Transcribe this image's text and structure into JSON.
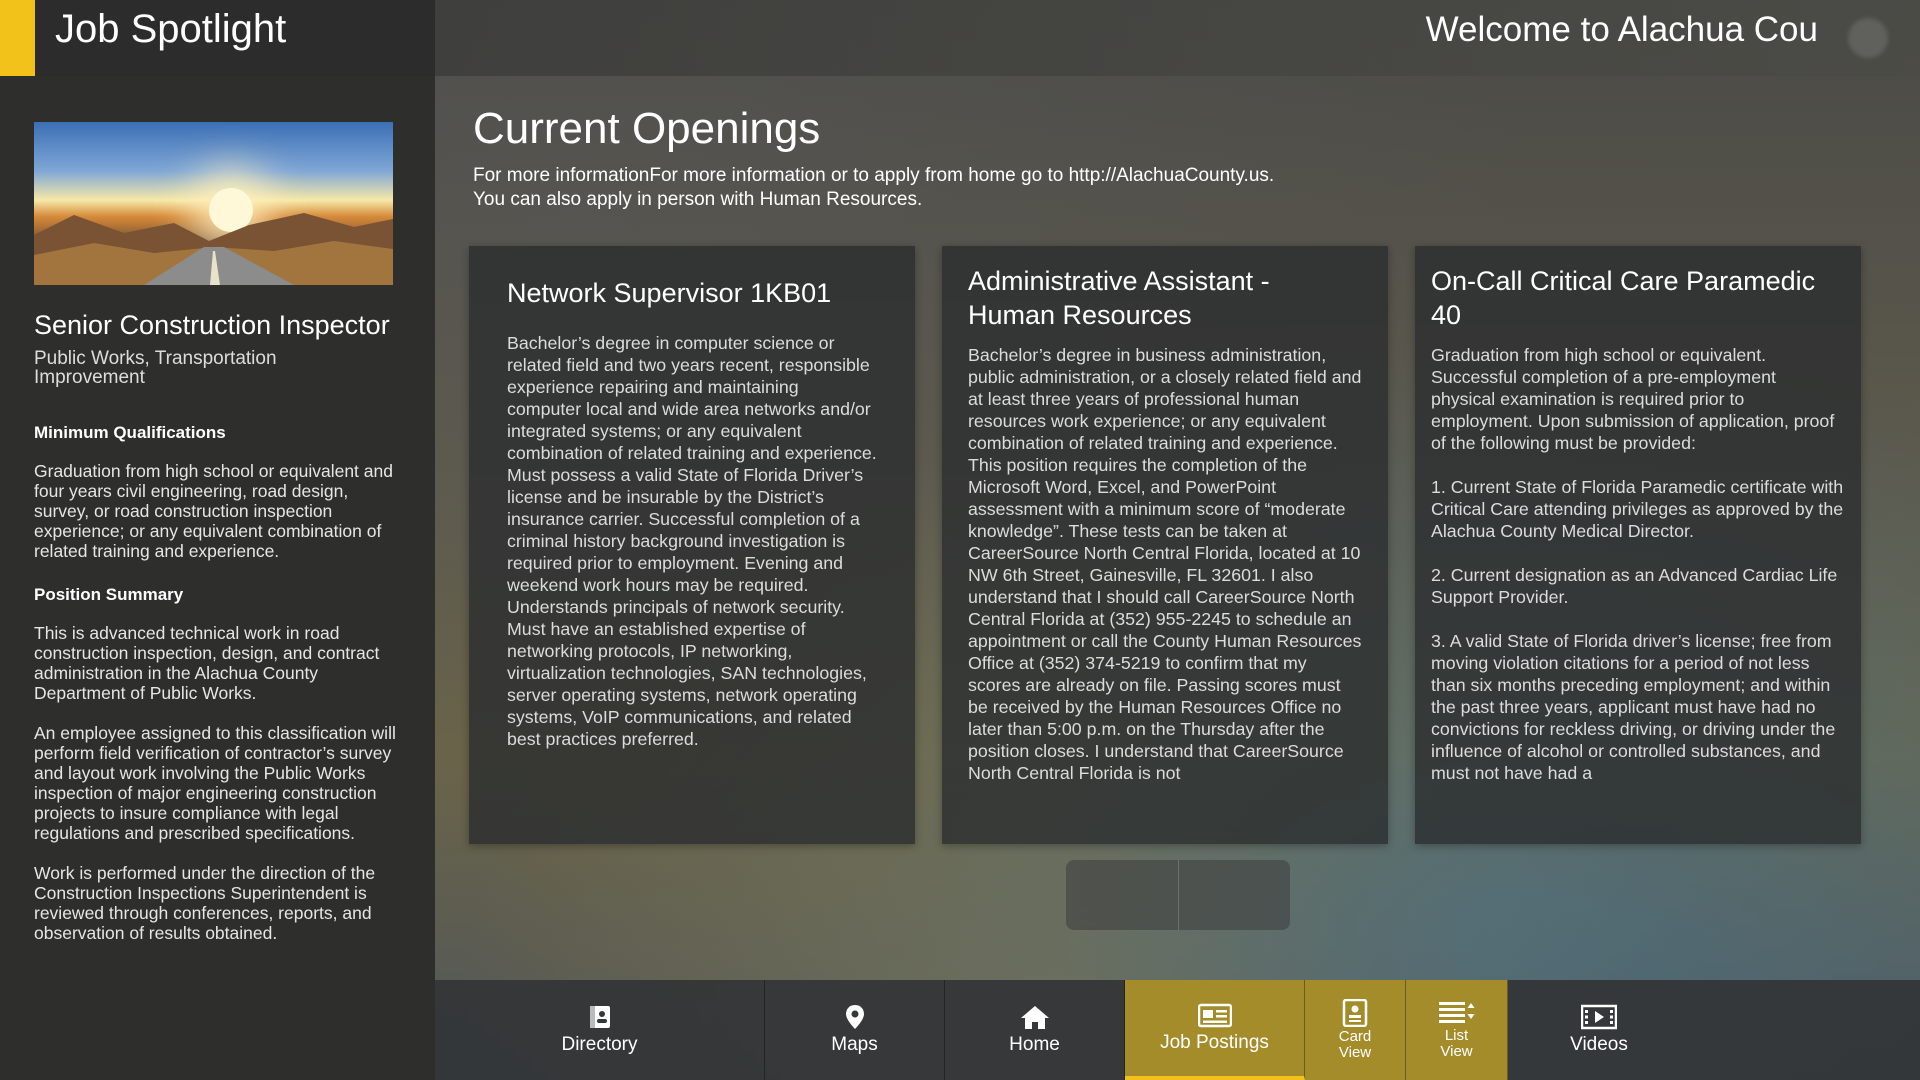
{
  "header": {
    "title": "Job Spotlight",
    "welcome": "Welcome to Alachua Cou"
  },
  "spotlight": {
    "job_title": "Senior Construction Inspector",
    "department": "Public Works, Transportation Improvement",
    "min_qual_heading": "Minimum Qualifications",
    "min_qual_text": "Graduation from high school or equivalent and four years civil engineering, road design, survey, or road construction inspection experience; or any equivalent combination of related training and experience.",
    "summary_heading": "Position Summary",
    "summary_paragraphs": [
      "This is advanced technical work in road construction inspection, design, and contract administration in the Alachua County Department of Public Works.",
      "An employee assigned to this classification will perform field verification of contractor’s survey and layout work involving the Public Works inspection of major engineering construction projects to insure compliance with legal regulations and prescribed specifications.",
      "Work is performed under the direction of the Construction Inspections Superintendent is reviewed through conferences, reports, and observation of results obtained."
    ]
  },
  "main": {
    "title": "Current Openings",
    "desc_line1": "For more informationFor more information or to apply from home go to http://AlachuaCounty.us.",
    "desc_line2": "You can also apply in person with Human Resources."
  },
  "cards": [
    {
      "title": "Network Supervisor 1KB01",
      "body": "Bachelor’s degree in computer science or related field and two years recent, responsible experience repairing and maintaining computer local and wide area networks and/or integrated systems; or any equivalent combination of related training and experience. Must possess a valid State of Florida Driver’s license and be insurable by the District’s insurance carrier. Successful completion of a criminal history background investigation is required prior to employment. Evening and weekend work hours may be required. Understands principals of network security. Must have an established expertise of networking protocols, IP networking, virtualization technologies, SAN technologies, server operating systems, network operating systems, VoIP communications, and related best practices preferred."
    },
    {
      "title": "Administrative Assistant - Human Resources",
      "body": "Bachelor’s degree in business administration, public administration, or a closely related field and at least three years of professional human resources work experience; or any equivalent combination of related training and experience. This position requires the completion of the Microsoft Word, Excel, and PowerPoint assessment with a minimum score of “moderate knowledge”. These tests can be taken at CareerSource North Central Florida, located at 10 NW 6th Street, Gainesville, FL 32601. I also understand that I should call CareerSource North Central Florida at (352) 955-2245 to schedule an appointment or call the County Human Resources Office at (352) 374-5219 to confirm that my scores are already on file. Passing scores must be received by the Human Resources Office no later than 5:00 p.m. on  the Thursday after the position closes. I understand that CareerSource North Central Florida is not"
    },
    {
      "title": "On-Call Critical Care Paramedic 40",
      "body": "Graduation from high school or equivalent. Successful completion of a pre-employment physical examination is required prior to employment. Upon submission of application, proof of the following must be provided:\n\n1. Current State of Florida Paramedic certificate with Critical Care attending privileges as approved by the Alachua  County Medical Director.\n\n2.  Current designation as an Advanced Cardiac Life Support Provider.\n\n3. A valid State of Florida driver’s license; free from moving violation citations for a period of not less than six months preceding employment; and within the past three years, applicant must have had no convictions for reckless driving, or driving under the influence of alcohol or controlled substances, and must not have had a"
    }
  ],
  "nav": {
    "directory": "Directory",
    "maps": "Maps",
    "home": "Home",
    "job_postings": "Job Postings",
    "card_view": "Card View",
    "list_view": "List View",
    "videos": "Videos"
  },
  "colors": {
    "accent": "#f2c21b",
    "active_nav": "#a58c2b"
  }
}
